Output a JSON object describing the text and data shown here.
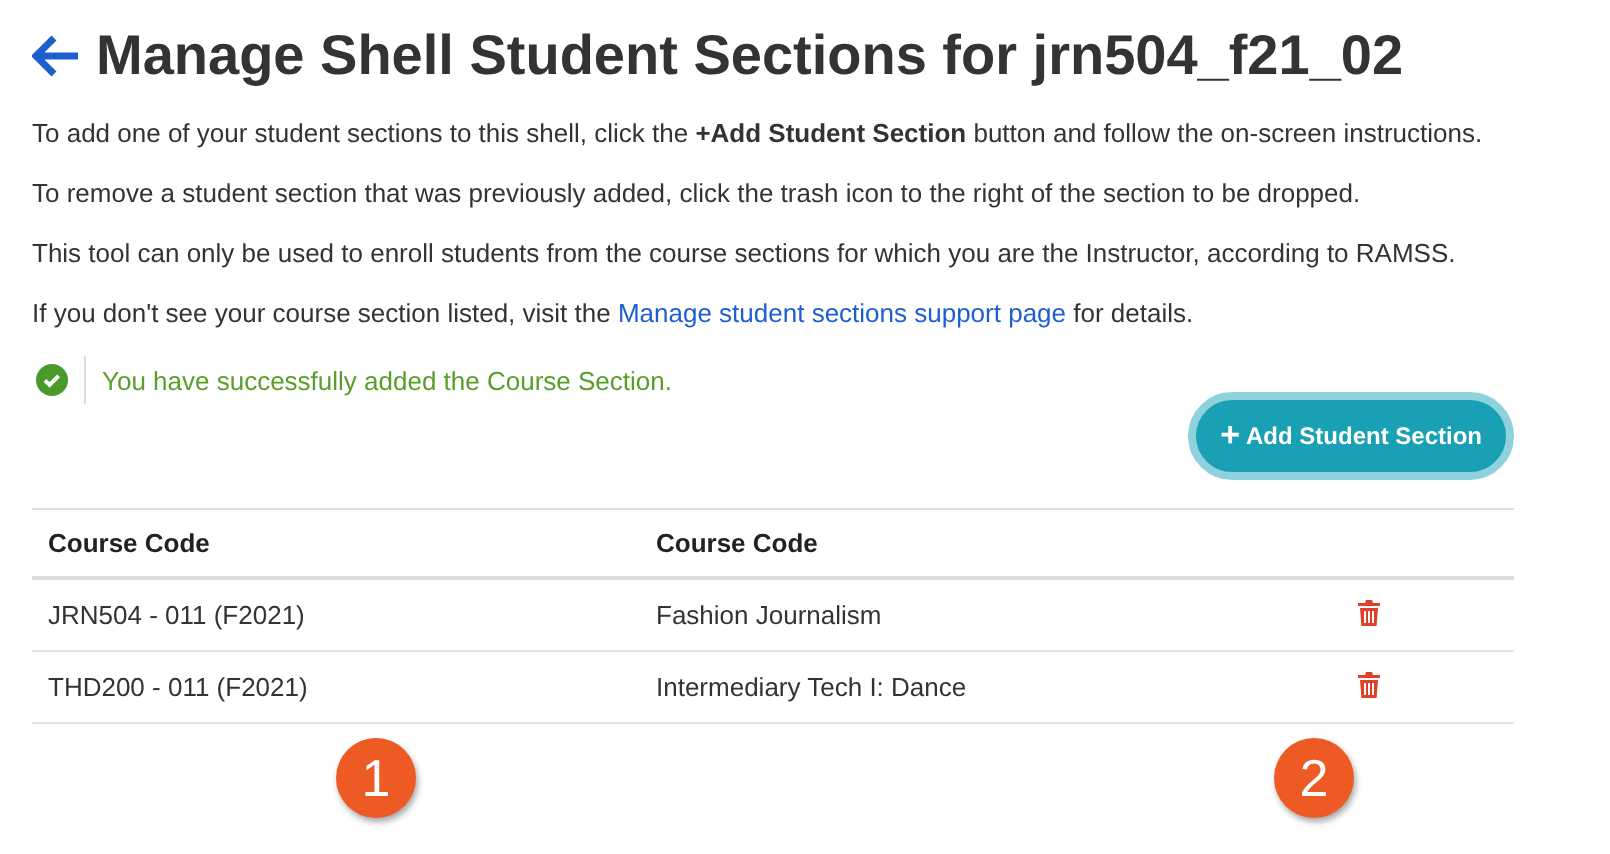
{
  "title": "Manage Shell Student Sections for jrn504_f21_02",
  "paragraphs": [
    {
      "text": "To add one of your student sections to this shell, click the **+Add Student Section** button and follow the on-screen instructions."
    },
    {
      "text": "To remove a student section that was previously added, click the trash icon to the right of the section to be dropped."
    },
    {
      "text": "This tool can only be used to enroll students from the course sections for which you are the Instructor, according to RAMSS."
    },
    {
      "text": "If you don't see your course section listed, visit the ",
      "link": "Manage student sections support page",
      "after": " for details."
    }
  ],
  "alert": {
    "kind": "success",
    "text": "You have successfully added the Course Section."
  },
  "add_button": {
    "icon": "+",
    "label": "Add Student Section"
  },
  "table": {
    "columns": [
      "Course Code",
      "Course Code"
    ],
    "rows": [
      {
        "code": "JRN504 - 011 (F2021)",
        "name": "Fashion Journalism"
      },
      {
        "code": "THD200 - 011 (F2021)",
        "name": "Intermediary Tech I: Dance"
      }
    ]
  },
  "callouts": [
    "1",
    "2"
  ]
}
